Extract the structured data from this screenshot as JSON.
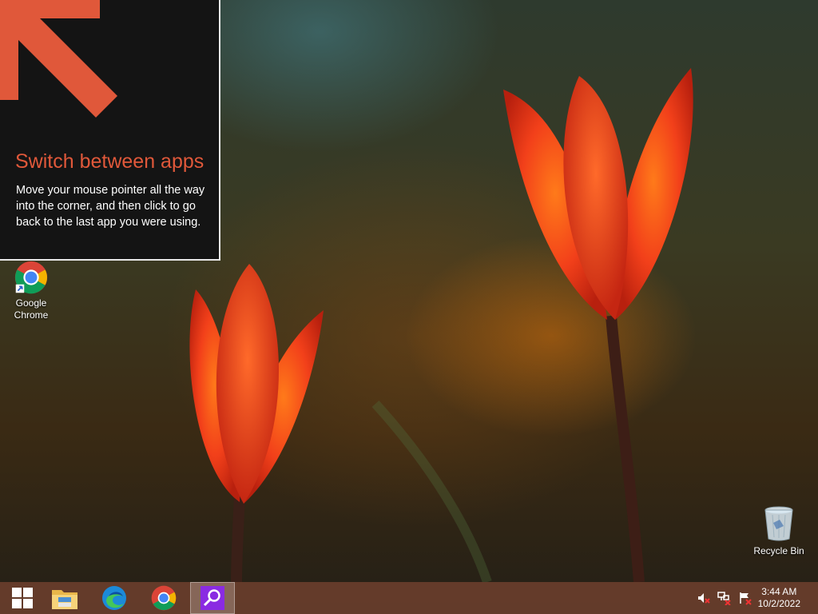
{
  "tip": {
    "title": "Switch between apps",
    "body": "Move your mouse pointer all the way into the corner, and then click to go back to the last app you were using."
  },
  "desktop": {
    "icons": [
      {
        "label_line1": "Google",
        "label_line2": "Chrome",
        "icon": "chrome-icon"
      },
      {
        "label": "Recycle Bin",
        "icon": "recycle-bin-icon"
      }
    ]
  },
  "taskbar": {
    "pinned": [
      {
        "name": "start",
        "icon": "windows-logo-icon"
      },
      {
        "name": "file-explorer",
        "icon": "folder-icon"
      },
      {
        "name": "edge",
        "icon": "edge-icon"
      },
      {
        "name": "chrome",
        "icon": "chrome-icon"
      },
      {
        "name": "search-app",
        "icon": "magnifier-icon",
        "active": true
      }
    ],
    "tray": [
      "speaker-muted-icon",
      "network-error-icon",
      "action-center-flag-icon"
    ],
    "clock": {
      "time": "3:44 AM",
      "date": "10/2/2022"
    }
  },
  "colors": {
    "accent": "#e0583a",
    "tip_bg": "#141414",
    "taskbar_bg": "#693e2c",
    "active_app": "#8a2be2"
  }
}
